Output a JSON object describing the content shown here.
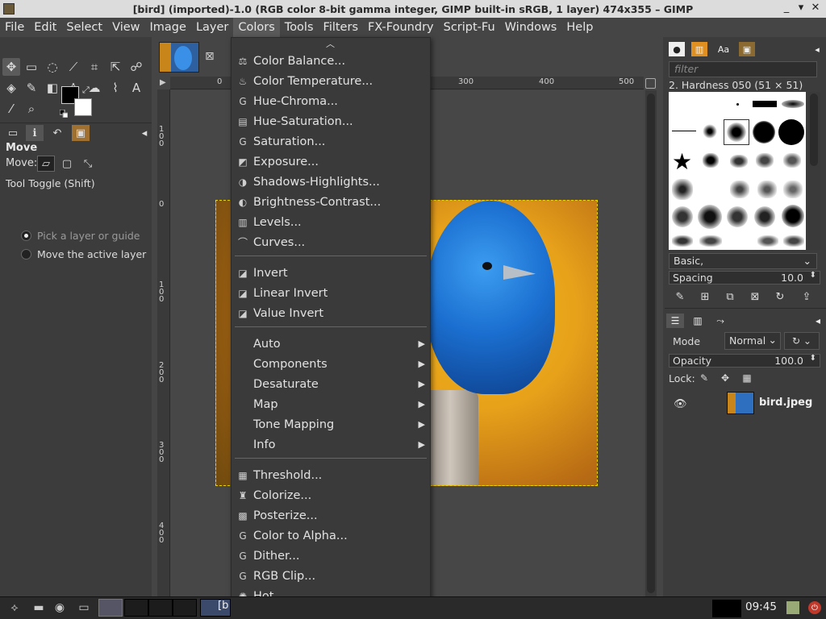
{
  "window": {
    "title": "[bird] (imported)-1.0 (RGB color 8-bit gamma integer, GIMP built-in sRGB, 1 layer) 474x355 – GIMP",
    "controls": [
      "_",
      "▾",
      "✕"
    ]
  },
  "menubar": {
    "items": [
      "File",
      "Edit",
      "Select",
      "View",
      "Image",
      "Layer",
      "Colors",
      "Tools",
      "Filters",
      "FX-Foundry",
      "Script-Fu",
      "Windows",
      "Help"
    ],
    "active": "Colors"
  },
  "toolbox": {
    "options_title": "Move",
    "move_label": "Move:",
    "toggle_label": "Tool Toggle  (Shift)",
    "radio_options": [
      "Pick a layer or guide",
      "Move the active layer"
    ],
    "fg_color": "#000000",
    "bg_color": "#ffffff"
  },
  "rulers": {
    "top": [
      "0",
      "300",
      "400",
      "500"
    ],
    "left": [
      "1\n0\n0",
      "0",
      "1\n0\n0",
      "2\n0\n0",
      "3\n0\n0",
      "4\n0\n0"
    ]
  },
  "colors_menu": {
    "group1": [
      {
        "label": "Color Balance...",
        "icon": "balance-icon"
      },
      {
        "label": "Color Temperature...",
        "icon": "temperature-icon"
      },
      {
        "label": "Hue-Chroma...",
        "icon": "gegl-icon"
      },
      {
        "label": "Hue-Saturation...",
        "icon": "hue-sat-icon"
      },
      {
        "label": "Saturation...",
        "icon": "gegl-icon"
      },
      {
        "label": "Exposure...",
        "icon": "exposure-icon"
      },
      {
        "label": "Shadows-Highlights...",
        "icon": "shadows-icon"
      },
      {
        "label": "Brightness-Contrast...",
        "icon": "brightness-icon"
      },
      {
        "label": "Levels...",
        "icon": "levels-icon"
      },
      {
        "label": "Curves...",
        "icon": "curves-icon"
      }
    ],
    "group2": [
      {
        "label": "Invert",
        "icon": "invert-icon"
      },
      {
        "label": "Linear Invert",
        "icon": "invert-icon"
      },
      {
        "label": "Value Invert",
        "icon": "invert-icon"
      }
    ],
    "group3": [
      {
        "label": "Auto"
      },
      {
        "label": "Components"
      },
      {
        "label": "Desaturate"
      },
      {
        "label": "Map"
      },
      {
        "label": "Tone Mapping"
      },
      {
        "label": "Info"
      }
    ],
    "group4": [
      {
        "label": "Threshold...",
        "icon": "threshold-icon"
      },
      {
        "label": "Colorize...",
        "icon": "colorize-icon"
      },
      {
        "label": "Posterize...",
        "icon": "posterize-icon"
      },
      {
        "label": "Color to Alpha...",
        "icon": "gegl-icon"
      },
      {
        "label": "Dither...",
        "icon": "gegl-icon"
      },
      {
        "label": "RGB Clip...",
        "icon": "gegl-icon"
      },
      {
        "label": "Hot...",
        "icon": "hot-icon"
      }
    ]
  },
  "brushes": {
    "filter_placeholder": "filter",
    "current": "2. Hardness 050 (51 × 51)",
    "set": "Basic,",
    "spacing_label": "Spacing",
    "spacing_value": "10.0"
  },
  "layers": {
    "mode_label": "Mode",
    "mode_value": "Normal",
    "opacity_label": "Opacity",
    "opacity_value": "100.0",
    "lock_label": "Lock:",
    "layer_name": "bird.jpeg"
  },
  "taskbar": {
    "clock": "09:45",
    "gimp_label": "[b"
  }
}
